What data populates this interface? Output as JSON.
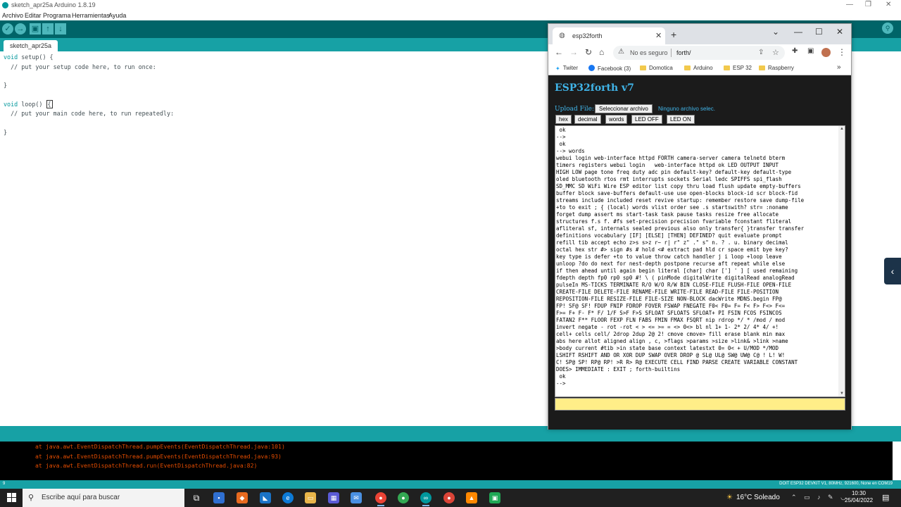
{
  "ide": {
    "title": "sketch_apr25a Arduino 1.8.19",
    "window_controls": [
      "—",
      "❐",
      "✕"
    ],
    "menu": [
      "Archivo",
      "Editar",
      "Programa",
      "Herramientas",
      "Ayuda"
    ],
    "toolbar": {
      "verify": "✓",
      "upload": "→",
      "new": "▣",
      "open": "↑",
      "save": "↓",
      "serial_monitor": "⚲"
    },
    "tab": "sketch_apr25a",
    "code": {
      "l1_kw": "void",
      "l1_rest": " setup() {",
      "l2": "  // put your setup code here, to run once:",
      "l3": "}",
      "l4_kw": "void",
      "l4_rest": " loop() ",
      "l4_brace": "{",
      "l5": "  // put your main code here, to run repeatedly:",
      "l6": "}"
    },
    "console": [
      "at java.awt.EventDispatchThread.pumpEvents(EventDispatchThread.java:101)",
      "at java.awt.EventDispatchThread.pumpEvents(EventDispatchThread.java:93)",
      "at java.awt.EventDispatchThread.run(EventDispatchThread.java:82)"
    ],
    "line_number": "9",
    "board_info": "DOIT ESP32 DEVKIT V1, 80MHz, 921600, None en COM19"
  },
  "chrome": {
    "tab_title": "esp32forth",
    "tab_close": "✕",
    "new_tab": "+",
    "window_controls": [
      "⌄",
      "—",
      "☐",
      "✕"
    ],
    "nav": {
      "back": "←",
      "forward": "→",
      "reload": "↻",
      "home": "⌂",
      "security_icon": "⚠",
      "security_text": "No es seguro",
      "url": "forth/",
      "share": "⇪",
      "star": "☆",
      "extensions": "✚",
      "sidebar": "▣",
      "menu": "⋮"
    },
    "bookmarks": [
      "Twiter",
      "Facebook (3)",
      "Domotica",
      "Arduino",
      "ESP 32",
      "Raspberry"
    ],
    "bookmarks_more": "»",
    "page": {
      "title": "ESP32forth v7",
      "upload_label": "Upload File:",
      "file_button": "Seleccionar archivo",
      "file_status": "Ninguno archivo selec.",
      "buttons": [
        "hex",
        "decimal",
        "words",
        "LED OFF",
        "LED ON"
      ],
      "terminal_lines": [
        " ok",
        "-->",
        " ok",
        "--> words",
        "webui login web-interface httpd FORTH camera-server camera telnetd bterm",
        "timers registers webui login   web-interface httpd ok LED OUTPUT INPUT",
        "HIGH LOW page tone freq duty adc pin default-key? default-key default-type",
        "oled bluetooth rtos rmt interrupts sockets Serial ledc SPIFFS spi_flash",
        "SD_MMC SD WiFi Wire ESP editor list copy thru load flush update empty-buffers",
        "buffer block save-buffers default-use use open-blocks block-id scr block-fid",
        "streams include included reset revive startup: remember restore save dump-file",
        "+to to exit ; { (local) words vlist order see .s startswith? str= :noname",
        "forget dump assert ms start-task task pause tasks resize free allocate",
        "structures f.s f. #fs set-precision precision fvariable fconstant fliteral",
        "afliteral sf, internals sealed previous also only transfer{ }transfer transfer",
        "definitions vocabulary [IF] [ELSE] [THEN] DEFINED? quit evaluate prompt",
        "refill tib accept echo z>s s>z r~ r| r\" z\" .\" s\" n. ? . u. binary decimal",
        "octal hex str #> sign #s # hold <# extract pad hld cr space emit bye key?",
        "key type is defer +to to value throw catch handler j i loop +loop leave",
        "unloop ?do do next for nest-depth postpone recurse aft repeat while else",
        "if then ahead until again begin literal [char] char ['] ' ] [ used remaining",
        "fdepth depth fp0 rp0 sp0 #! \\ ( pinMode digitalWrite digitalRead analogRead",
        "pulseIn MS-TICKS TERMINATE R/O W/O R/W BIN CLOSE-FILE FLUSH-FILE OPEN-FILE",
        "CREATE-FILE DELETE-FILE RENAME-FILE WRITE-FILE READ-FILE FILE-POSITION",
        "REPOSITION-FILE RESIZE-FILE FILE-SIZE NON-BLOCK dacWrite MDNS.begin FP@",
        "FP! SF@ SF! FDUP FNIP FDROP FOVER FSWAP FNEGATE F0< F0= F= F< F> F<> F<=",
        "F>= F+ F- F* F/ 1/F S>F F>S SFLOAT SFLOATS SFLOAT+ PI FSIN FCOS FSINCOS",
        "FATAN2 F** FLOOR FEXP FLN FABS FMIN FMAX FSQRT nip rdrop */ * /mod / mod",
        "invert negate - rot -rot < > <= >= = <> 0<> bl nl 1+ 1- 2* 2/ 4* 4/ +!",
        "cell+ cells cell/ 2drop 2dup 2@ 2! cmove cmove> fill erase blank min max",
        "abs here allot aligned align , c, >flags >params >size >link& >link >name",
        ">body current #tib >in state base context latestxt 0= 0< + U/MOD */MOD",
        "LSHIFT RSHIFT AND OR XOR DUP SWAP OVER DROP @ SL@ UL@ SW@ UW@ C@ ! L! W!",
        "C! SP@ SP! RP@ RP! >R R> R@ EXECUTE CELL FIND PARSE CREATE VARIABLE CONSTANT",
        "DOES> IMMEDIATE : EXIT ; forth-builtins",
        " ok",
        "-->"
      ],
      "input_value": ""
    }
  },
  "taskbar": {
    "search_placeholder": "Escribe aquí para buscar",
    "weather": "16°C  Soleado",
    "weather_icon": "☀",
    "tray": "⌃ ▭ ♪ ✎ ◡",
    "time": "10:30",
    "date": "25/04/2022",
    "notification_icon": "▤"
  },
  "colors": {
    "arduino_dark": "#006468",
    "arduino_teal": "#17a1a5",
    "esp_title": "#40b4e8",
    "console_text": "#e34c00",
    "input_bg": "#ffee88"
  }
}
